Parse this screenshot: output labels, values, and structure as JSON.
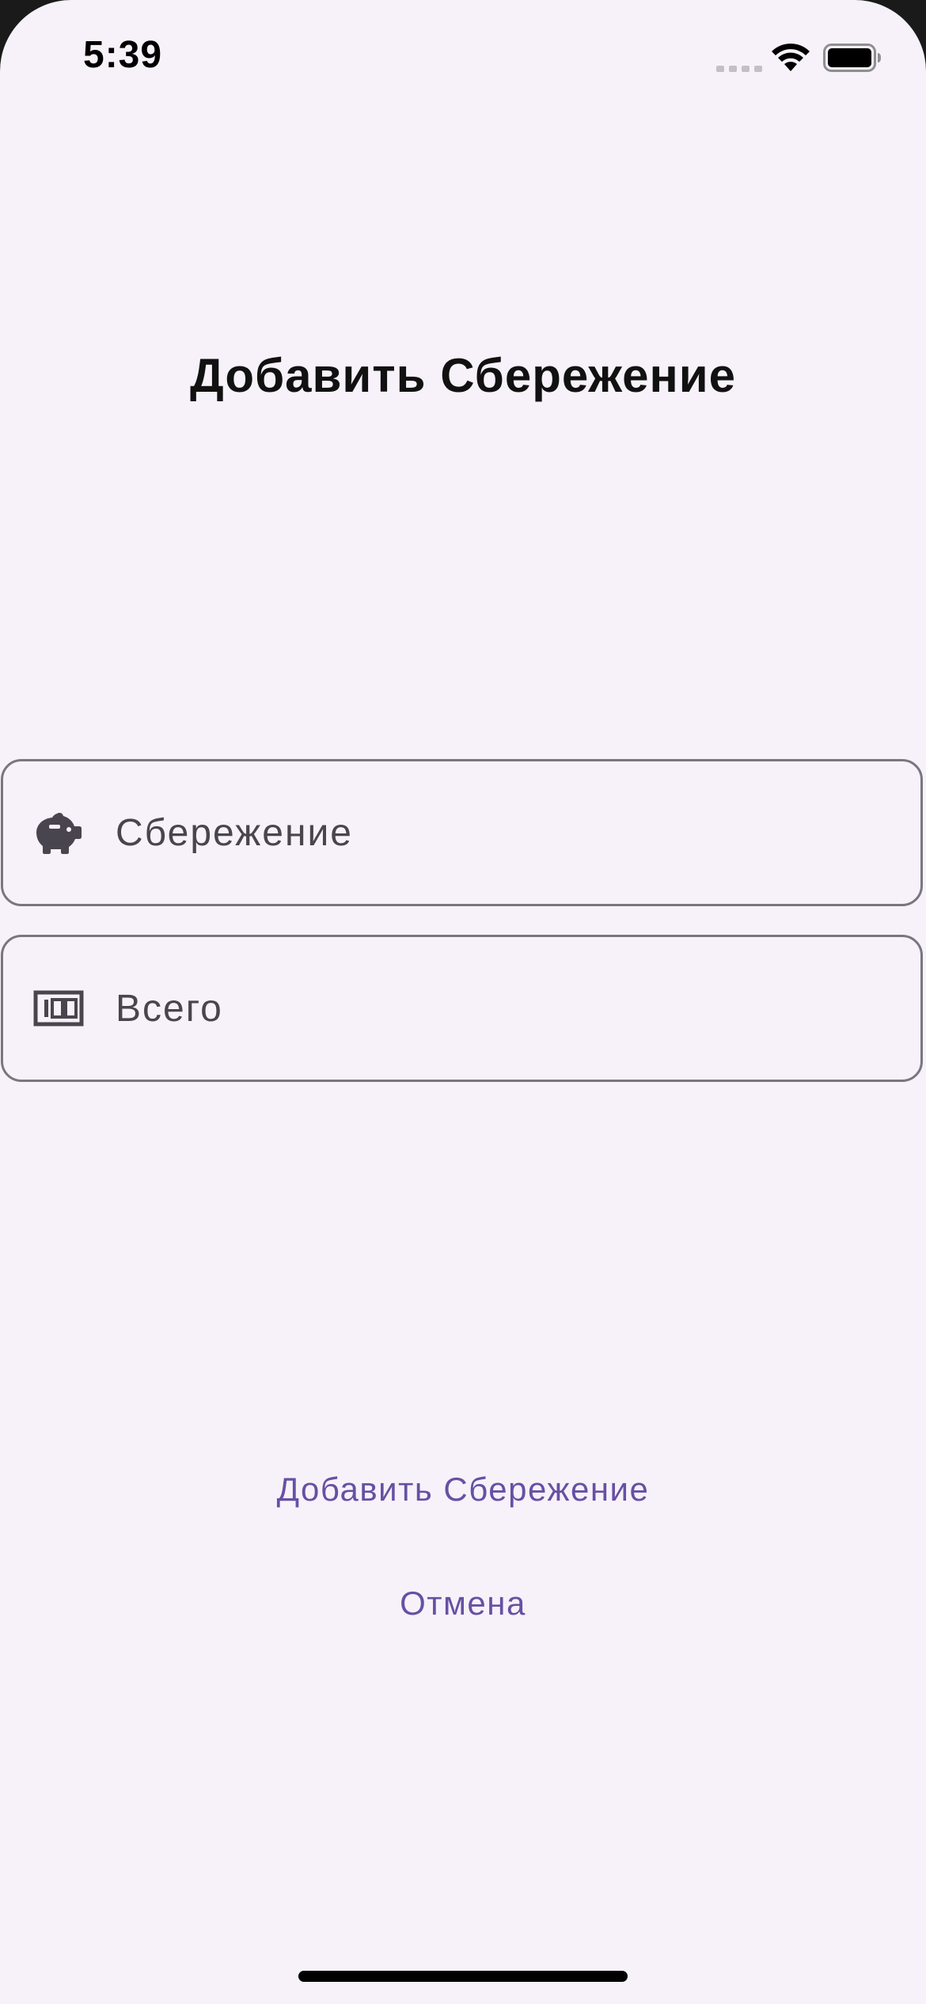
{
  "status_bar": {
    "time": "5:39"
  },
  "page": {
    "title": "Добавить Сбережение"
  },
  "fields": {
    "saving": {
      "placeholder": "Сбережение",
      "value": "",
      "icon": "piggy-bank-icon"
    },
    "total": {
      "placeholder": "Всего",
      "value": "",
      "icon": "numbers-icon"
    }
  },
  "actions": {
    "add_label": "Добавить Сбережение",
    "cancel_label": "Отмена"
  },
  "colors": {
    "background": "#f7f2f9",
    "accent": "#6750a4",
    "field_border": "#7a7680",
    "text_secondary": "#49454f"
  }
}
